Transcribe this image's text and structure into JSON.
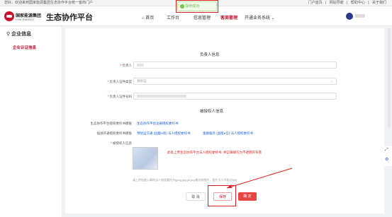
{
  "topbar": {
    "welcome": "您好，欢迎来到国家能源集团生态协作平台统一客商门户",
    "links": [
      "门户首页",
      "|",
      "网站导航",
      "|",
      "帮助中心",
      "|",
      "关于我们"
    ]
  },
  "header": {
    "logo_cn": "国家能源集团",
    "logo_en": "CHN ENERGY",
    "platform_title": "生态协作平台",
    "nav": {
      "home": "首页",
      "workbench": "工作台",
      "info": "信息管理",
      "merchant": "客商管理",
      "open_business": "开通业务系统"
    }
  },
  "toast": {
    "message": "保存成功"
  },
  "sidebar": {
    "title": "企业信息",
    "item": "企业认证信息"
  },
  "form": {
    "section_principal": "负责人信息",
    "principal_label": "负责人",
    "id_type_label": "负责人证件类型",
    "id_type_value": "身份证",
    "id_no_label": "负责人证件号码",
    "section_auth": "被授权人信息",
    "template_label_1": "生态协作平台授权委托书模板",
    "template_link_1": "生态协作平台注册授权委托书",
    "template_label_2": "插进开通授权委托书模板",
    "template_link_2a": "预估运交通 (国能e商) 法人授权委托书",
    "template_link_2b": "金融服务 (国能e信) 法人授权委托书",
    "auth_label": "被授权人信息",
    "upload_note": "此处上传生态协作平台法人授权委托书, 并正确填写为不透明的背景",
    "upload_hint": "请上传加盖公章的法人授权委托书(jpeg,jpg,gif,png格式的图片，图片大小不超过5M)"
  },
  "buttons": {
    "cancel": "取 消",
    "save": "保存",
    "confirm": "确 定"
  },
  "colors": {
    "brand": "#c8102e",
    "link": "#1a5fd8",
    "highlight": "#e02020"
  }
}
